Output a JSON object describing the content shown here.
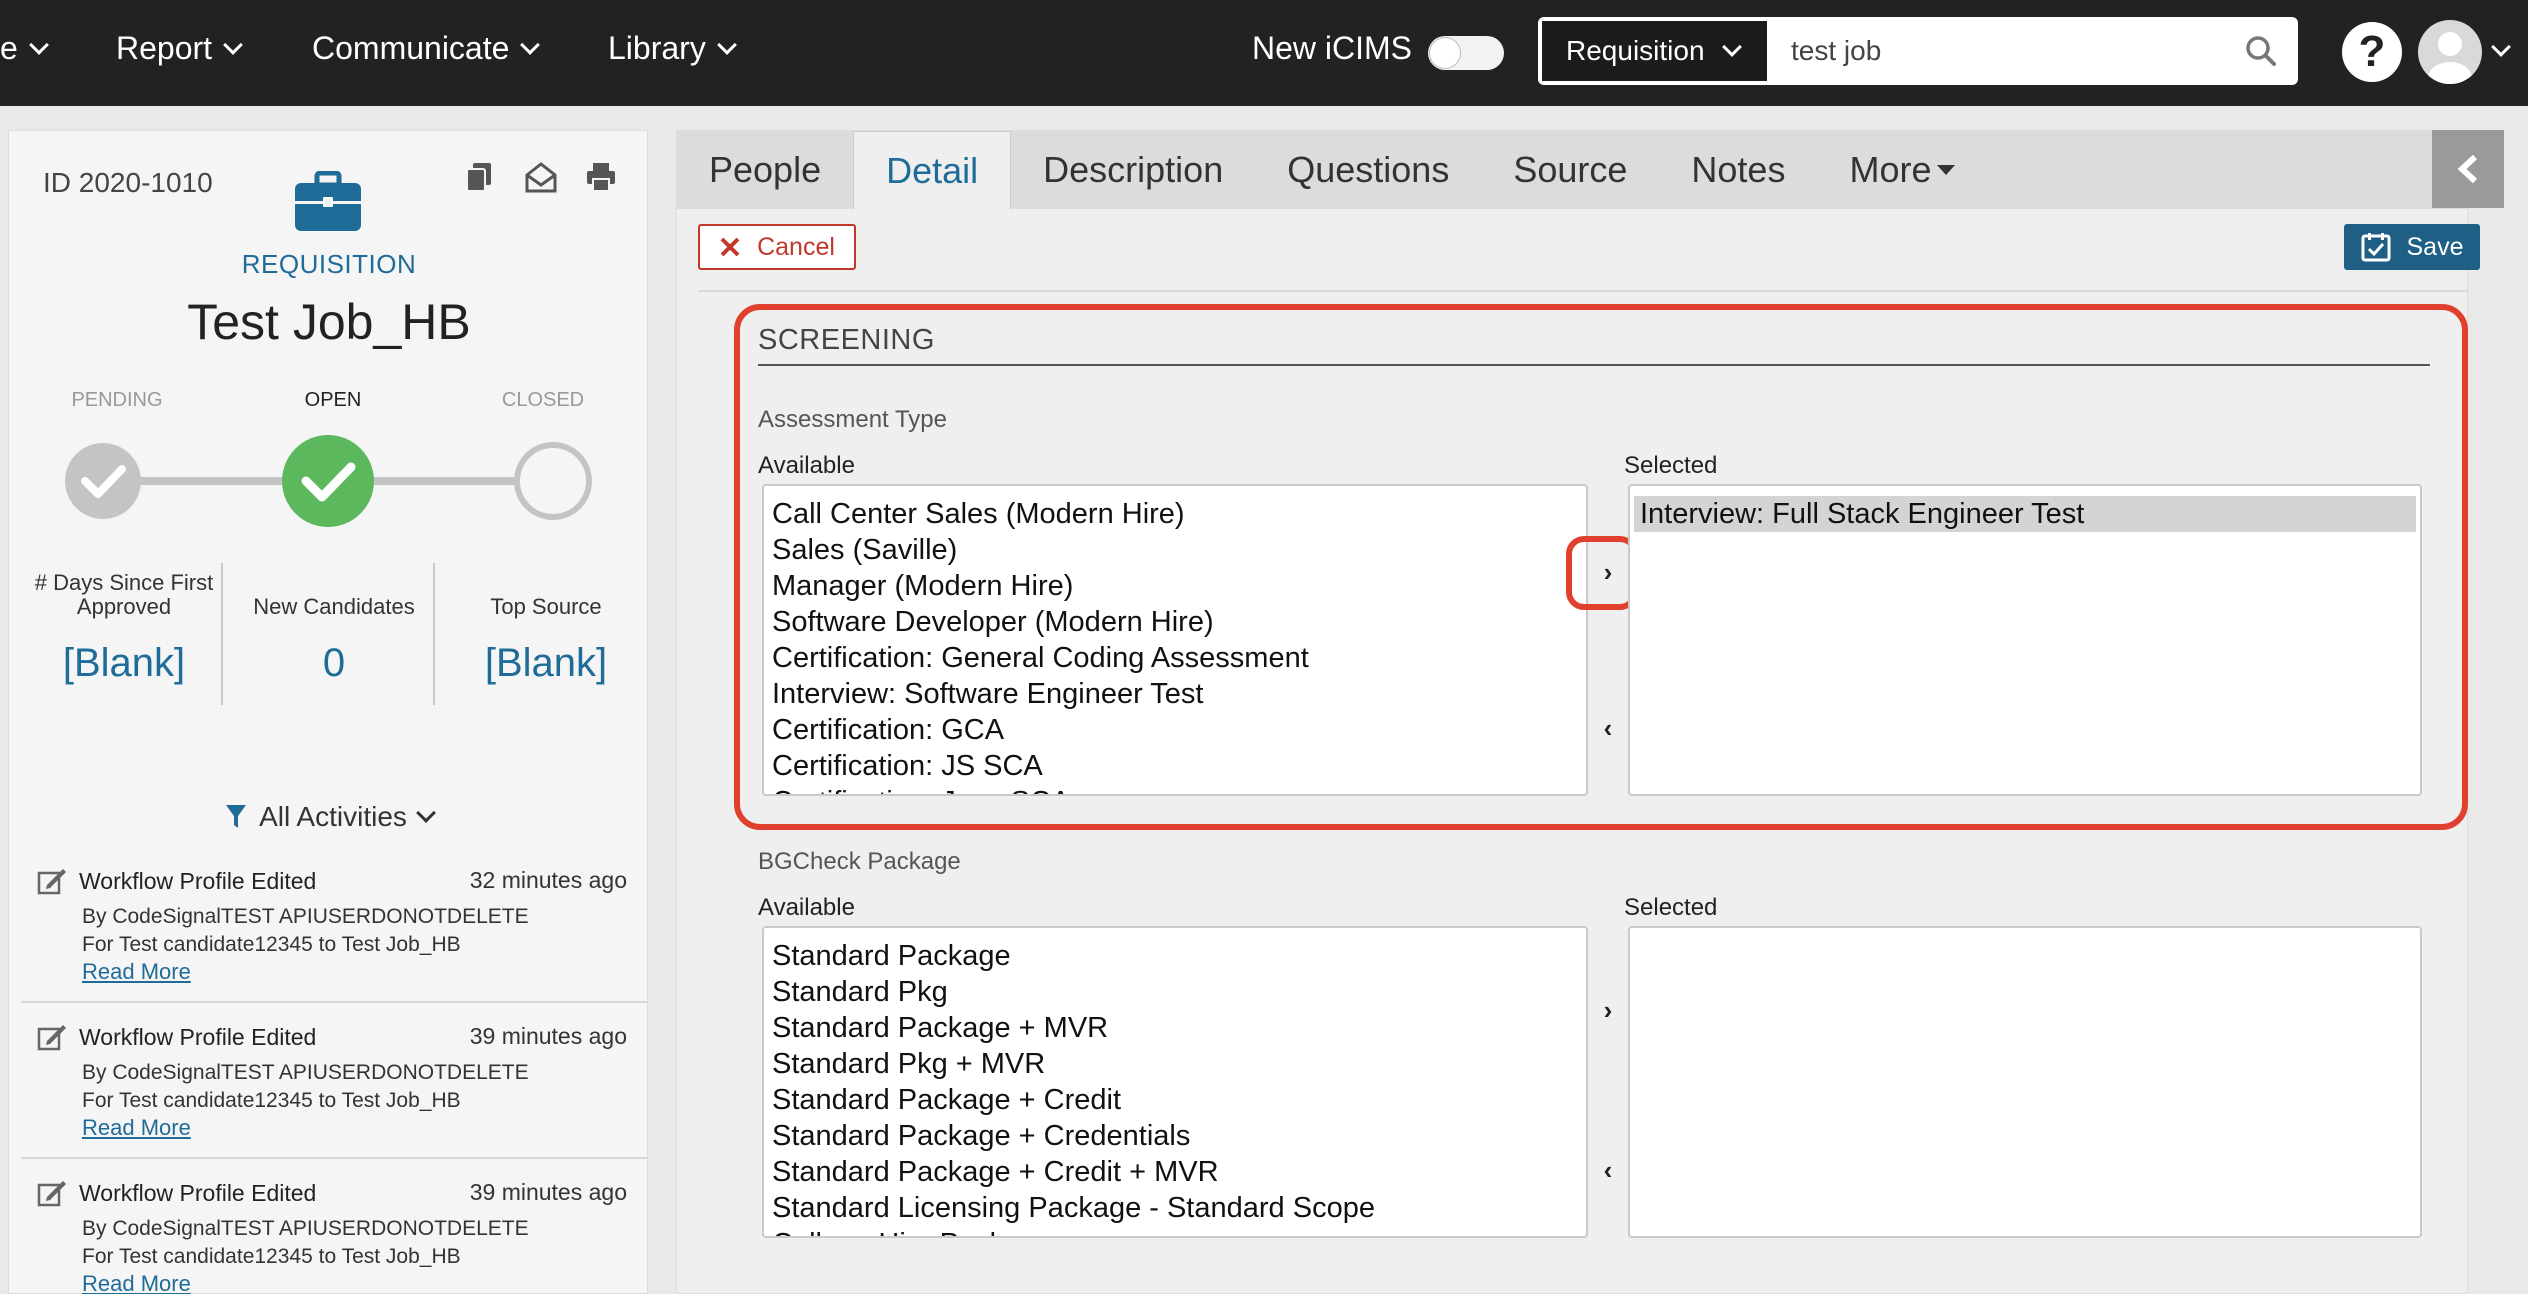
{
  "topnav": {
    "items": [
      {
        "label": "e"
      },
      {
        "label": "Report"
      },
      {
        "label": "Communicate"
      },
      {
        "label": "Library"
      }
    ],
    "new_icims_label": "New iCIMS",
    "new_icims_enabled": false,
    "search_type": "Requisition",
    "search_value": "test job",
    "help_label": "?"
  },
  "record": {
    "id": "ID 2020-1010",
    "type_label": "REQUISITION",
    "title": "Test Job_HB",
    "stages": [
      {
        "label": "PENDING",
        "state": "done"
      },
      {
        "label": "OPEN",
        "state": "current"
      },
      {
        "label": "CLOSED",
        "state": "upcoming"
      }
    ],
    "stats": [
      {
        "label": "# Days Since First Approved",
        "value": "[Blank]"
      },
      {
        "label": "New Candidates",
        "value": "0"
      },
      {
        "label": "Top Source",
        "value": "[Blank]"
      }
    ]
  },
  "activities": {
    "filter_label": "All Activities",
    "items": [
      {
        "title": "Workflow Profile Edited",
        "time": "32 minutes ago",
        "by": "By CodeSignalTEST APIUSERDONOTDELETE",
        "for": "For Test candidate12345 to Test Job_HB",
        "link": "Read More"
      },
      {
        "title": "Workflow Profile Edited",
        "time": "39 minutes ago",
        "by": "By CodeSignalTEST APIUSERDONOTDELETE",
        "for": "For Test candidate12345 to Test Job_HB",
        "link": "Read More"
      },
      {
        "title": "Workflow Profile Edited",
        "time": "39 minutes ago",
        "by": "By CodeSignalTEST APIUSERDONOTDELETE",
        "for": "For Test candidate12345 to Test Job_HB",
        "link": "Read More"
      }
    ]
  },
  "tabs": [
    {
      "label": "People",
      "active": false
    },
    {
      "label": "Detail",
      "active": true
    },
    {
      "label": "Description",
      "active": false
    },
    {
      "label": "Questions",
      "active": false
    },
    {
      "label": "Source",
      "active": false
    },
    {
      "label": "Notes",
      "active": false
    },
    {
      "label": "More",
      "active": false
    }
  ],
  "actions": {
    "cancel_label": "Cancel",
    "save_label": "Save"
  },
  "screening": {
    "section_title": "SCREENING",
    "assessment": {
      "label": "Assessment Type",
      "available_label": "Available",
      "selected_label": "Selected",
      "available": [
        "Call Center Sales (Modern Hire)",
        "Sales (Saville)",
        "Manager (Modern Hire)",
        "Software Developer (Modern Hire)",
        "Certification: General Coding Assessment",
        "Interview: Software Engineer Test",
        "Certification: GCA",
        "Certification: JS SCA",
        "Certification: Java SCA"
      ],
      "selected": [
        "Interview: Full Stack Engineer Test"
      ]
    },
    "bgcheck": {
      "label": "BGCheck Package",
      "available_label": "Available",
      "selected_label": "Selected",
      "available": [
        "Standard Package",
        "Standard Pkg",
        "Standard Package + MVR",
        "Standard Pkg + MVR",
        "Standard Package + Credit",
        "Standard Package + Credentials",
        "Standard Package + Credit + MVR",
        "Standard Licensing Package - Standard Scope",
        "College Hire Package"
      ],
      "selected": []
    },
    "move_right_symbol": "›",
    "move_left_symbol": "‹"
  },
  "colors": {
    "accent": "#1f6c98",
    "highlight": "#e0412f",
    "stage_done": "#c4c4c4",
    "stage_current": "#5cb85c"
  }
}
